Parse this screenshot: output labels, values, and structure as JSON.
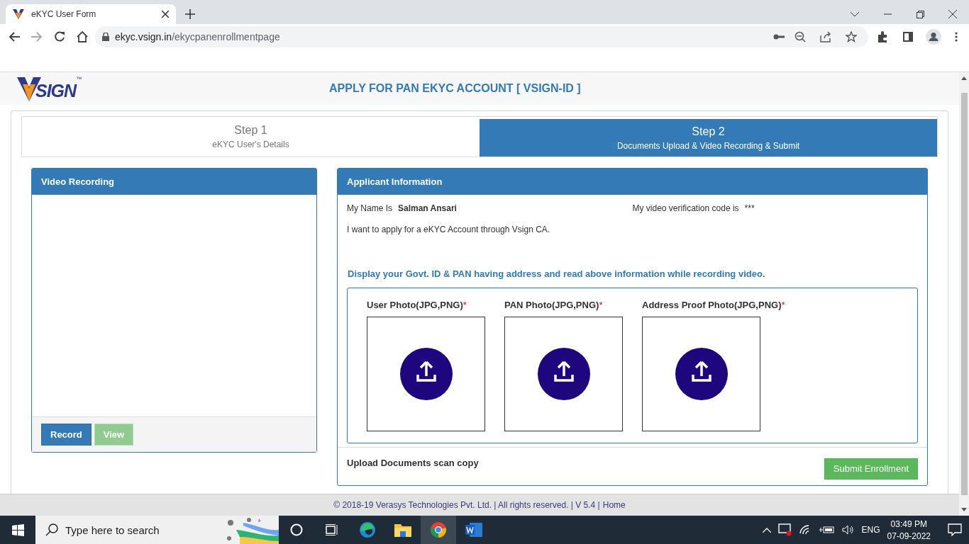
{
  "browser": {
    "tab_title": "eKYC User Form",
    "url_host": "ekyc.vsign.in",
    "url_path": "/ekycpanenrollmentpage"
  },
  "header": {
    "logo_text": "SIGN",
    "logo_tm": "™",
    "title": "APPLY FOR PAN EKYC ACCOUNT [ VSIGN-ID ]"
  },
  "steps": [
    {
      "title": "Step 1",
      "subtitle": "eKYC User's Details",
      "selected": false
    },
    {
      "title": "Step 2",
      "subtitle": "Documents Upload & Video Recording & Submit",
      "selected": true
    }
  ],
  "video_panel": {
    "title": "Video Recording",
    "buttons": [
      {
        "label": "Record",
        "kind": "primary",
        "disabled": false
      },
      {
        "label": "View",
        "kind": "success",
        "disabled": true
      }
    ]
  },
  "applicant_panel": {
    "title": "Applicant Information",
    "name_label": "My Name Is",
    "name_value": "Salman Ansari",
    "code_label": "My video verification code is",
    "code_value": "***",
    "statement": "I want to apply for a eKYC Account through Vsign CA.",
    "instruction": "Display your Govt. ID & PAN having address and read above information while recording video.",
    "uploads": [
      {
        "label": "User Photo(JPG,PNG)",
        "required_mark": "*"
      },
      {
        "label": "PAN Photo(JPG,PNG)",
        "required_mark": "*"
      },
      {
        "label": "Address Proof Photo(JPG,PNG)",
        "required_mark": "*"
      }
    ],
    "footer_text": "Upload Documents scan copy",
    "submit": "Submit Enrollment"
  },
  "footer": {
    "text": "©  2018-19  Verasys Technologies Pvt. Ltd. | All rights reserved. | V 5.4 |",
    "link": "Home"
  },
  "taskbar": {
    "search_placeholder": "Type here to search",
    "language": "ENG",
    "time": "03:49 PM",
    "date": "07-09-2022"
  }
}
